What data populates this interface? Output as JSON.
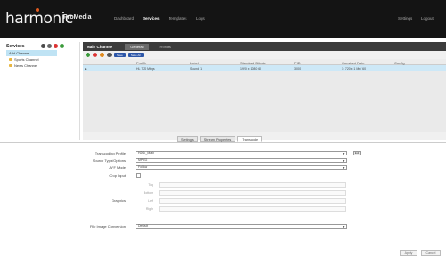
{
  "header": {
    "logo": "harmonic",
    "product": "ProMedia",
    "nav": [
      "Dashboard",
      "Services",
      "Templates",
      "Logs"
    ],
    "nav_active": "Services",
    "right_links": [
      "Settings",
      "Logout"
    ],
    "accent": "#e05a1e"
  },
  "sidebar": {
    "title": "Services",
    "items": [
      {
        "label": "Add Channel",
        "selected": true
      },
      {
        "label": "Sports Channel",
        "selected": false
      },
      {
        "label": "News Channel",
        "selected": false
      }
    ]
  },
  "main": {
    "title": "Main Channel",
    "tabs": [
      {
        "label": "General",
        "active": true
      },
      {
        "label": "Profiles",
        "active": false
      }
    ],
    "toolbar_pills": [
      "Save",
      "Save All"
    ],
    "columns": [
      "Profile",
      "Label",
      "Standard Bitrate",
      "PID",
      "Constant Rate",
      "Config"
    ],
    "rows": [
      [
        "HL 720 Mbps",
        "Sound 1",
        "1920 x 1080 60",
        "3000",
        "1: 720 x 1 Mb/ 60",
        ""
      ]
    ]
  },
  "panel_tabs": [
    {
      "label": "Settings",
      "active": false
    },
    {
      "label": "Stream Properties",
      "active": false
    },
    {
      "label": "Transcode",
      "active": true
    }
  ],
  "form": {
    "transcoding_profile": {
      "label": "Transcoding Profile",
      "value": "H264_Main"
    },
    "source_type": {
      "label": "Source Type/Options",
      "value": "MPEG"
    },
    "aff_mode": {
      "label": "AFF Mode",
      "value": "Follow"
    },
    "crop_input": {
      "label": "Crop Input"
    },
    "crop_fields": {
      "top": "Top",
      "bottom": "Bottom",
      "left": "Left",
      "right": "Right"
    },
    "graphics": {
      "label": "Graphics"
    },
    "image_conversion": {
      "label": "File Image Conversion",
      "value": "Default"
    },
    "edit_label": "Edit"
  },
  "footer": {
    "apply": "Apply",
    "cancel": "Cancel"
  }
}
